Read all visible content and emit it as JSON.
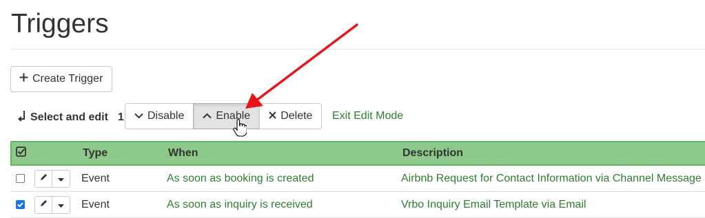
{
  "page": {
    "title": "Triggers"
  },
  "toolbar": {
    "create_label": "Create Trigger",
    "select_label": "Select and edit",
    "selected_count": "1",
    "disable_label": "Disable",
    "enable_label": "Enable",
    "delete_label": "Delete",
    "exit_label": "Exit Edit Mode"
  },
  "table": {
    "columns": [
      "Type",
      "When",
      "Description"
    ],
    "rows": [
      {
        "checked": false,
        "type": "Event",
        "when": "As soon as booking is created",
        "description": "Airbnb Request for Contact Information via Channel Message"
      },
      {
        "checked": true,
        "type": "Event",
        "when": "As soon as inquiry is received",
        "description": "Vrbo Inquiry Email Template via Email"
      }
    ]
  },
  "colors": {
    "accent_green": "#2e7d32",
    "header_green": "#8cc98a",
    "header_border": "#5cb85c",
    "annotation_red": "#e8141a",
    "checkbox_blue": "#1a73e8"
  },
  "icons": [
    "plus-icon",
    "enter-arrow-icon",
    "chevron-down-icon",
    "chevron-up-icon",
    "times-icon",
    "checkbox-check-icon",
    "pencil-icon",
    "caret-down-icon",
    "hand-cursor-icon",
    "red-annotation-arrow"
  ]
}
